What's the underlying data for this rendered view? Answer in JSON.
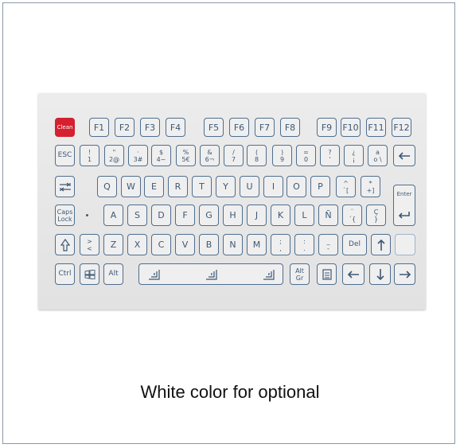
{
  "caption": "White color for optional",
  "colors": {
    "clean_key": "#d5202f",
    "key_outline": "#4f6e8f",
    "panel": "#e8e8e8"
  },
  "keyboard": {
    "row1": [
      "Clean",
      "F1",
      "F2",
      "F3",
      "F4",
      "F5",
      "F6",
      "F7",
      "F8",
      "F9",
      "F10",
      "F11",
      "F12"
    ],
    "row2": [
      "ESC",
      "!|1|",
      "\"|2@",
      "·|3#",
      "$|4~",
      "%|5€",
      "&|6¬",
      "/|7",
      "(|8",
      ")|9",
      "=|0",
      "?|'",
      "¿|¡",
      "a|o \\"
    ],
    "row3": [
      "Q",
      "W",
      "E",
      "R",
      "T",
      "Y",
      "U",
      "I",
      "O",
      "P",
      "^|`[",
      "*|+]"
    ],
    "row4": [
      "A",
      "S",
      "D",
      "F",
      "G",
      "H",
      "J",
      "K",
      "L",
      "Ñ",
      "¨|´{",
      "Ç|}"
    ],
    "row5": [
      "Z",
      "X",
      "C",
      "V",
      "B",
      "N",
      "M",
      ";|,",
      ":|.",
      "_|-"
    ],
    "labels": {
      "enter": "Enter",
      "caps": "Caps",
      "lock": "Lock",
      "ctrl": "Ctrl",
      "alt": "Alt",
      "altgr_top": "Alt",
      "altgr_bottom": "Gr",
      "del": "Del",
      "gt": ">",
      "lt": "<"
    },
    "icons": [
      "backspace-icon",
      "tab-icon",
      "enter-arrow-icon",
      "shift-icon",
      "up-arrow-icon",
      "windows-icon",
      "space-grid-icon",
      "menu-icon",
      "left-arrow-icon",
      "down-arrow-icon",
      "right-arrow-icon"
    ]
  }
}
